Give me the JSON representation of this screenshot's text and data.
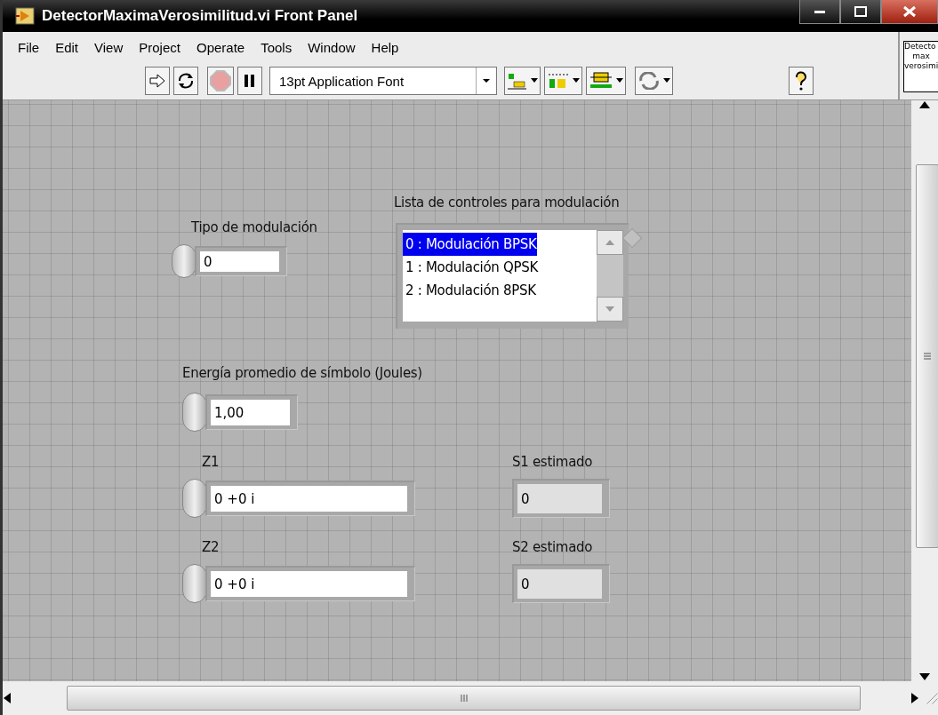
{
  "window": {
    "title": "DetectorMaximaVerosimilitud.vi Front Panel"
  },
  "menu": [
    "File",
    "Edit",
    "View",
    "Project",
    "Operate",
    "Tools",
    "Window",
    "Help"
  ],
  "toolbar": {
    "font": "13pt Application Font"
  },
  "vi_icon": {
    "lines": [
      "Detecto",
      "max",
      "verosimi"
    ]
  },
  "controls": [
    {
      "kind": "numeric",
      "label": "Tipo de modulación",
      "value": "0"
    },
    {
      "kind": "listbox",
      "label": "Lista de controles para modulación",
      "items": [
        {
          "text": "0 : Modulación BPSK",
          "selected": true
        },
        {
          "text": "1 : Modulación QPSK",
          "selected": false
        },
        {
          "text": "2 : Modulación 8PSK",
          "selected": false
        }
      ]
    },
    {
      "kind": "numeric",
      "label": "Energía promedio de símbolo (Joules)",
      "value": "1,00"
    },
    {
      "kind": "numeric",
      "label": "Z1",
      "value": "0 +0 i"
    },
    {
      "kind": "indicator",
      "label": "S1 estimado",
      "value": "0"
    },
    {
      "kind": "numeric",
      "label": "Z2",
      "value": "0 +0 i"
    },
    {
      "kind": "indicator",
      "label": "S2 estimado",
      "value": "0"
    }
  ]
}
